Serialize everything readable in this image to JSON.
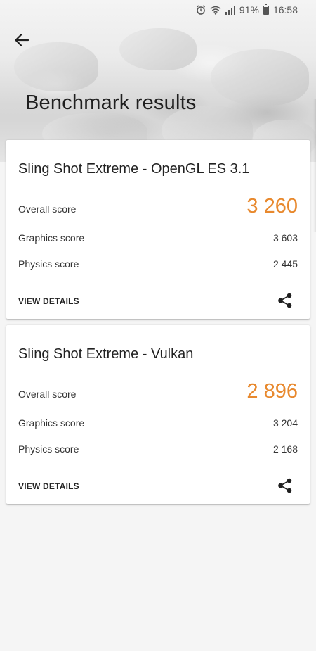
{
  "status_bar": {
    "battery_percent": "91%",
    "time": "16:58",
    "icons": [
      "alarm-icon",
      "wifi-icon",
      "signal-icon",
      "battery-icon"
    ]
  },
  "header": {
    "title": "Benchmark results",
    "back_icon": "back-arrow-icon"
  },
  "results": [
    {
      "title": "Sling Shot Extreme - OpenGL ES 3.1",
      "overall_label": "Overall score",
      "overall_value": "3 260",
      "graphics_label": "Graphics score",
      "graphics_value": "3 603",
      "physics_label": "Physics score",
      "physics_value": "2 445",
      "details_label": "VIEW DETAILS",
      "share_icon": "share-icon"
    },
    {
      "title": "Sling Shot Extreme - Vulkan",
      "overall_label": "Overall score",
      "overall_value": "2 896",
      "graphics_label": "Graphics score",
      "graphics_value": "3 204",
      "physics_label": "Physics score",
      "physics_value": "2 168",
      "details_label": "VIEW DETAILS",
      "share_icon": "share-icon"
    }
  ],
  "colors": {
    "accent_score": "#e8892e",
    "background": "#f5f5f5",
    "card": "#ffffff"
  }
}
